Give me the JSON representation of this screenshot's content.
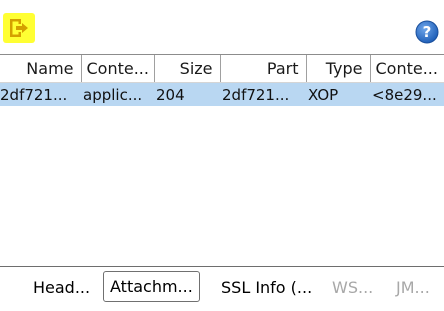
{
  "toolbar": {
    "export_icon": "export-arrow-icon",
    "help_icon": "help-question-icon",
    "help_glyph": "?",
    "colors": {
      "export_highlight": "#ffff33",
      "export_icon": "#d4a000",
      "help_bg": "#2f6fc7"
    }
  },
  "table": {
    "columns": [
      "Name",
      "Conte...",
      "Size",
      "Part",
      "Type",
      "Conte..."
    ],
    "rows": [
      [
        "2df721...",
        "applic...",
        "204",
        "2df721...",
        "XOP",
        "<8e29..."
      ]
    ],
    "selected_row_color": "#b9d7f2"
  },
  "tabs": [
    {
      "label": "Head...",
      "active": false,
      "disabled": false
    },
    {
      "label": "Attachm...",
      "active": true,
      "disabled": false
    },
    {
      "label": "SSL Info (...",
      "active": false,
      "disabled": false
    },
    {
      "label": "WS...",
      "active": false,
      "disabled": true
    },
    {
      "label": "JM...",
      "active": false,
      "disabled": true
    }
  ]
}
